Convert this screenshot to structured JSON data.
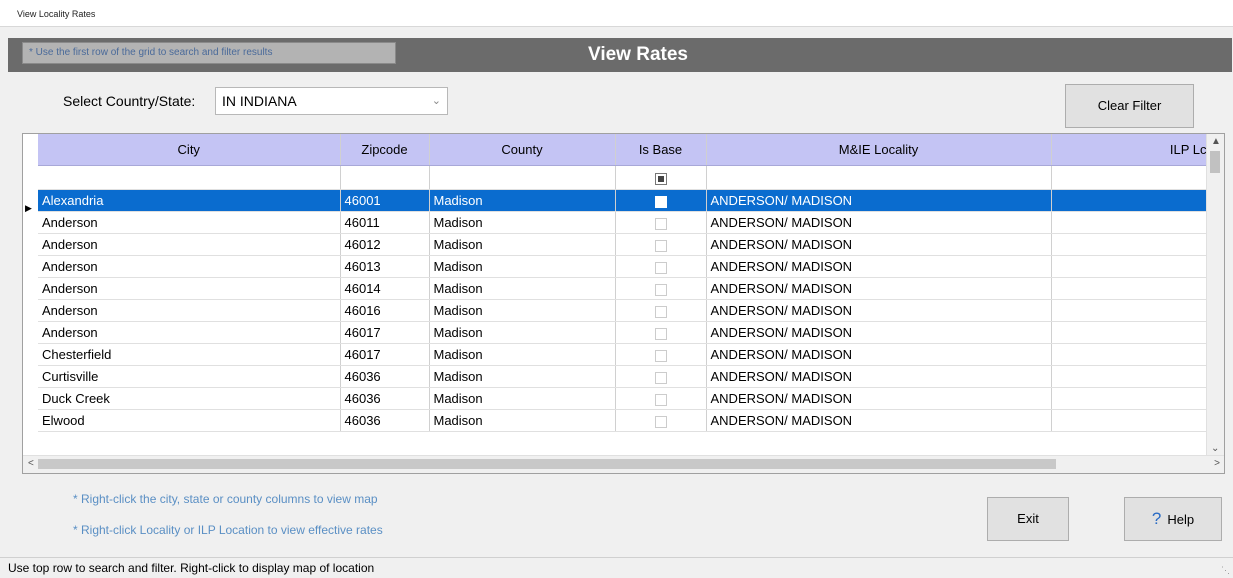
{
  "window": {
    "title": "View Locality Rates"
  },
  "header": {
    "hint": "* Use the first row of the grid to search and filter results",
    "title": "View Rates"
  },
  "filter": {
    "label": "Select Country/State:",
    "selected": "IN INDIANA",
    "clear_button": "Clear Filter"
  },
  "grid": {
    "columns": [
      "City",
      "Zipcode",
      "County",
      "Is Base",
      "M&IE Locality",
      "ILP Lc"
    ],
    "rows": [
      {
        "city": "Alexandria",
        "zip": "46001",
        "county": "Madison",
        "locality": "ANDERSON/ MADISON"
      },
      {
        "city": "Anderson",
        "zip": "46011",
        "county": "Madison",
        "locality": "ANDERSON/ MADISON"
      },
      {
        "city": "Anderson",
        "zip": "46012",
        "county": "Madison",
        "locality": "ANDERSON/ MADISON"
      },
      {
        "city": "Anderson",
        "zip": "46013",
        "county": "Madison",
        "locality": "ANDERSON/ MADISON"
      },
      {
        "city": "Anderson",
        "zip": "46014",
        "county": "Madison",
        "locality": "ANDERSON/ MADISON"
      },
      {
        "city": "Anderson",
        "zip": "46016",
        "county": "Madison",
        "locality": "ANDERSON/ MADISON"
      },
      {
        "city": "Anderson",
        "zip": "46017",
        "county": "Madison",
        "locality": "ANDERSON/ MADISON"
      },
      {
        "city": "Chesterfield",
        "zip": "46017",
        "county": "Madison",
        "locality": "ANDERSON/ MADISON"
      },
      {
        "city": "Curtisville",
        "zip": "46036",
        "county": "Madison",
        "locality": "ANDERSON/ MADISON"
      },
      {
        "city": "Duck Creek",
        "zip": "46036",
        "county": "Madison",
        "locality": "ANDERSON/ MADISON"
      },
      {
        "city": "Elwood",
        "zip": "46036",
        "county": "Madison",
        "locality": "ANDERSON/ MADISON"
      }
    ],
    "selected_row": 0
  },
  "notes": {
    "map": "* Right-click the city, state or county columns to view map",
    "rates": "* Right-click Locality or ILP Location to view effective rates"
  },
  "buttons": {
    "exit": "Exit",
    "help": "Help"
  },
  "status": "Use top row to search and filter. Right-click to display map of location",
  "colors": {
    "header_band": "#6b6b6b",
    "selection": "#0a6ccf",
    "column_header": "#c4c4f4"
  }
}
